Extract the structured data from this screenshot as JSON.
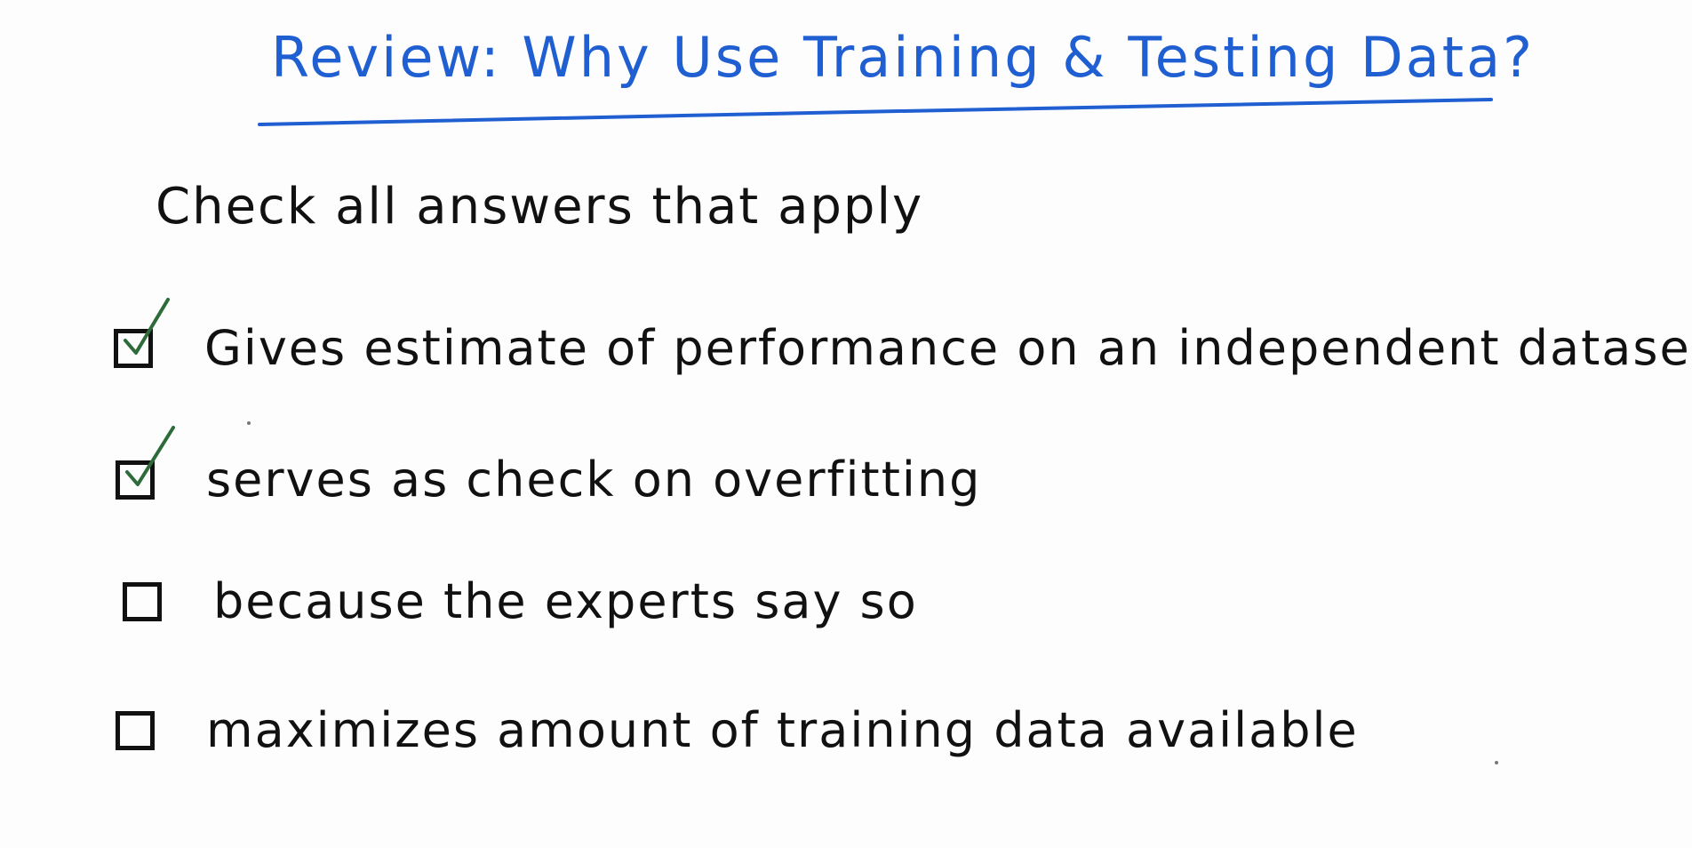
{
  "title": "Review: Why Use Training & Testing Data?",
  "instruction": "Check all answers that apply",
  "options": [
    {
      "label": "Gives estimate of performance on an independent dataset",
      "checked": true
    },
    {
      "label": "serves as check on overfitting",
      "checked": true
    },
    {
      "label": "because the experts say so",
      "checked": false
    },
    {
      "label": "maximizes amount of training data available",
      "checked": false
    }
  ],
  "colors": {
    "title": "#1f5fd1",
    "ink": "#111111",
    "check": "#2e6b3a"
  }
}
